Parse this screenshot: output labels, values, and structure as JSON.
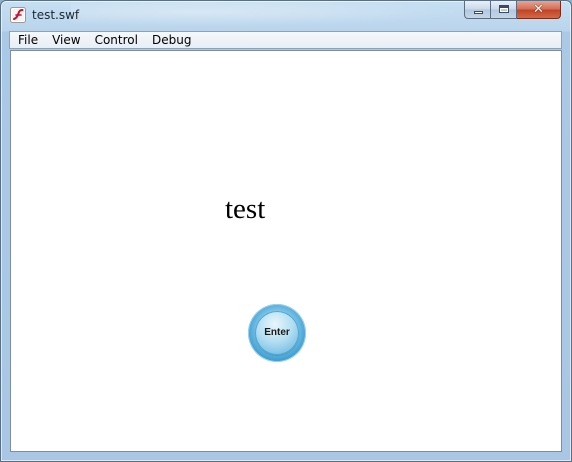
{
  "window": {
    "title": "test.swf",
    "icon": "flash-player-icon"
  },
  "caption_buttons": {
    "minimize_icon": "minimize-icon",
    "maximize_icon": "maximize-icon",
    "close_icon": "close-icon",
    "close_glyph": "✕"
  },
  "menubar": {
    "items": [
      {
        "label": "File"
      },
      {
        "label": "View"
      },
      {
        "label": "Control"
      },
      {
        "label": "Debug"
      }
    ]
  },
  "stage": {
    "text": "test",
    "enter_button_label": "Enter"
  },
  "colors": {
    "frame": "#a9c7e4",
    "stage_background": "#ffffff",
    "button_accent": "#3c9fd3",
    "close_button": "#c04427"
  }
}
